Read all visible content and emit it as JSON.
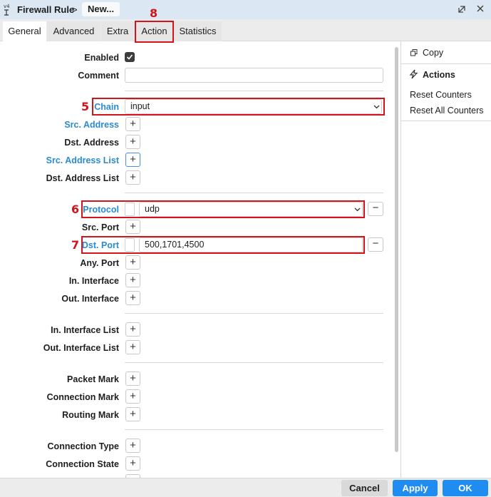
{
  "window": {
    "title": "Firewall Rule",
    "separator": ">",
    "crumb": "New...",
    "restore_icon": "restore-icon",
    "close_icon": "close-icon"
  },
  "tabs": [
    {
      "label": "General",
      "active": true
    },
    {
      "label": "Advanced",
      "active": false
    },
    {
      "label": "Extra",
      "active": false
    },
    {
      "label": "Action",
      "active": false
    },
    {
      "label": "Statistics",
      "active": false
    }
  ],
  "annotations": {
    "tab_action": "8",
    "chain": "5",
    "protocol": "6",
    "dst_port": "7"
  },
  "form": {
    "enabled_label": "Enabled",
    "enabled_checked": true,
    "comment_label": "Comment",
    "comment_value": "",
    "chain_label": "Chain",
    "chain_value": "input",
    "src_address_label": "Src. Address",
    "dst_address_label": "Dst. Address",
    "src_address_list_label": "Src. Address List",
    "dst_address_list_label": "Dst. Address List",
    "protocol_label": "Protocol",
    "protocol_value": "udp",
    "src_port_label": "Src. Port",
    "dst_port_label": "Dst. Port",
    "dst_port_value": "500,1701,4500",
    "any_port_label": "Any. Port",
    "in_interface_label": "In. Interface",
    "out_interface_label": "Out. Interface",
    "in_interface_list_label": "In. Interface List",
    "out_interface_list_label": "Out. Interface List",
    "packet_mark_label": "Packet Mark",
    "connection_mark_label": "Connection Mark",
    "routing_mark_label": "Routing Mark",
    "connection_type_label": "Connection Type",
    "connection_state_label": "Connection State",
    "add_symbol": "+",
    "remove_symbol": "−"
  },
  "side_panel": {
    "copy_label": "Copy",
    "actions_label": "Actions",
    "reset_counters_label": "Reset Counters",
    "reset_all_counters_label": "Reset All Counters"
  },
  "footer": {
    "cancel_label": "Cancel",
    "apply_label": "Apply",
    "ok_label": "OK"
  },
  "colors": {
    "accent": "#1e8cf0",
    "link_label": "#2a8bd2",
    "highlight": "#d4141c",
    "titlebar": "#dbe8f4"
  }
}
